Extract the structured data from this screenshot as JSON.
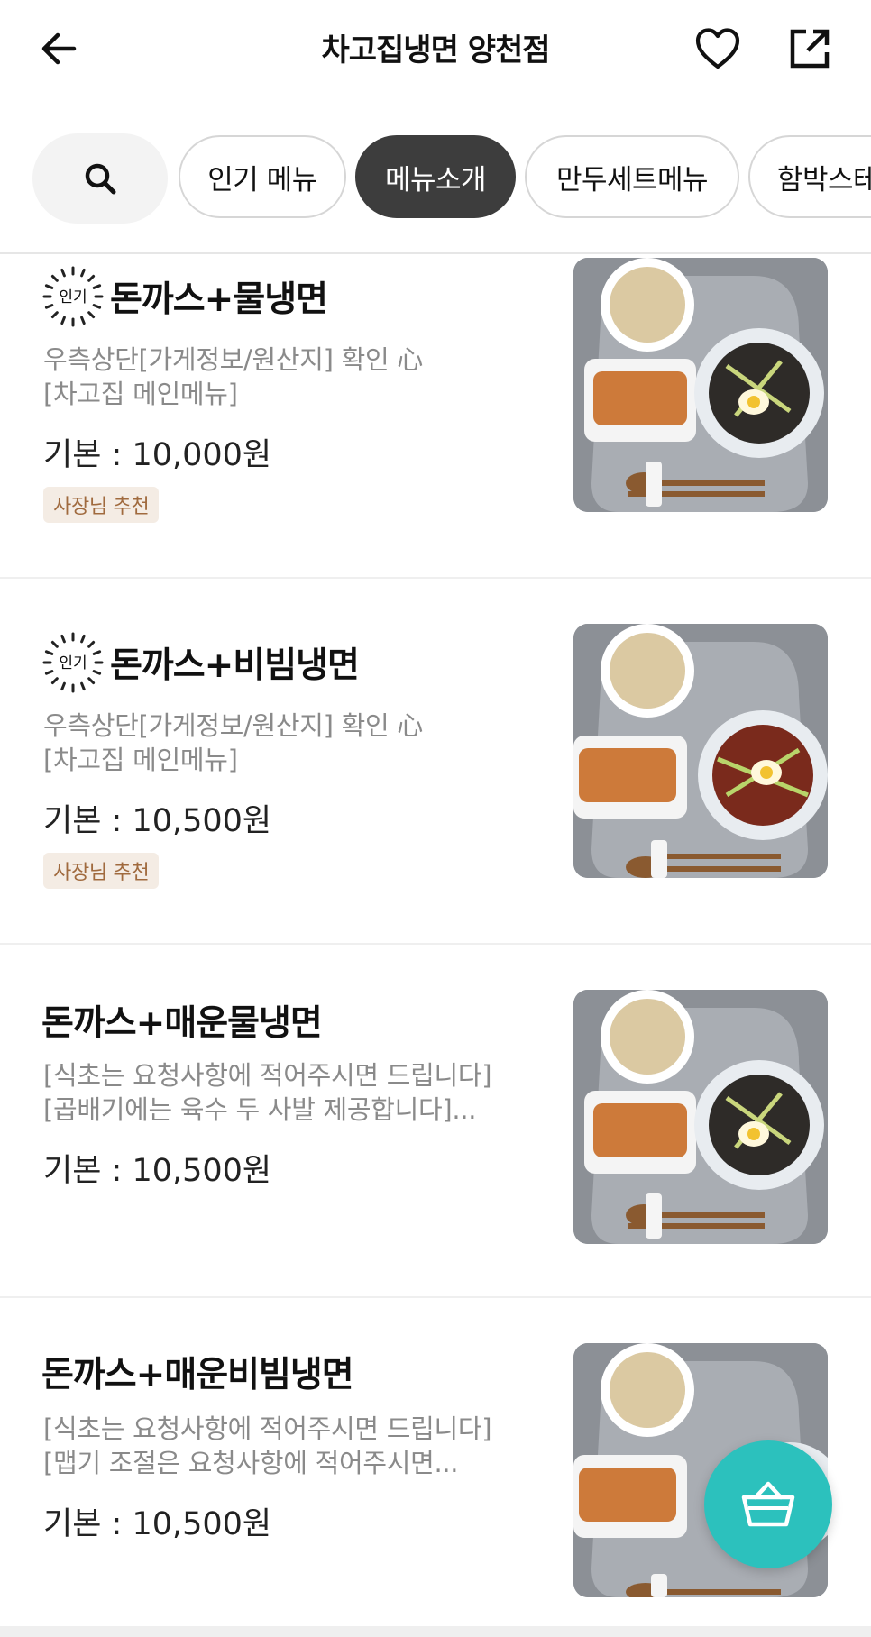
{
  "header": {
    "title": "차고집냉면 양천점"
  },
  "tabs": [
    {
      "label": "인기 메뉴",
      "active": false
    },
    {
      "label": "메뉴소개",
      "active": true
    },
    {
      "label": "만두세트메뉴",
      "active": false
    },
    {
      "label": "함박스테",
      "active": false
    }
  ],
  "popular_badge_text": "인기",
  "items": [
    {
      "name": "돈까스+물냉면",
      "desc1": "우측상단[가게정보/원산지] 확인 心",
      "desc2": "[차고집 메인메뉴]",
      "price": "기본 : 10,000원",
      "recommend": "사장님 추천"
    },
    {
      "name": "돈까스+비빔냉면",
      "desc1": "우측상단[가게정보/원산지] 확인 心",
      "desc2": "[차고집 메인메뉴]",
      "price": "기본 : 10,500원",
      "recommend": "사장님 추천"
    },
    {
      "name": "돈까스+매운물냉면",
      "desc1": "[식초는 요청사항에 적어주시면 드립니다]",
      "desc2": "[곱배기에는 육수 두 사발 제공합니다]...",
      "price": "기본 : 10,500원"
    },
    {
      "name": "돈까스+매운비빔냉면",
      "desc1": "[식초는 요청사항에 적어주시면 드립니다]",
      "desc2": "[맵기 조절은 요청사항에 적어주시면...",
      "price": "기본 : 10,500원"
    }
  ],
  "colors": {
    "accent": "#2cc1bd",
    "active_tab": "#3d3d3d",
    "recommend_bg": "#f4ece4",
    "recommend_text": "#a06a3e"
  }
}
